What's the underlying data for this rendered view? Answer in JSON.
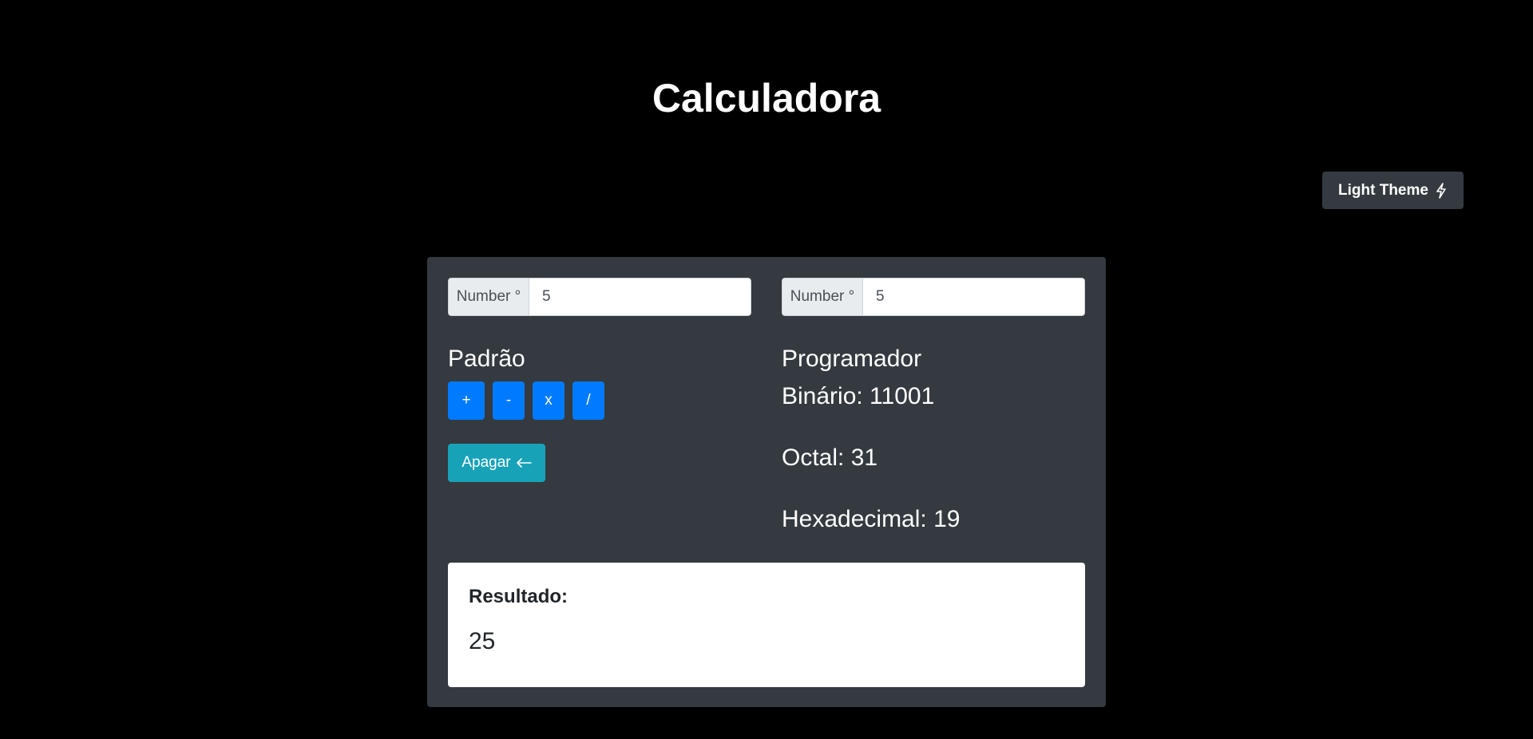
{
  "page": {
    "title": "Calculadora"
  },
  "theme_button": {
    "label": "Light Theme",
    "icon": "lightning-icon"
  },
  "inputs": {
    "first": {
      "addon": "Number °",
      "value": "5"
    },
    "second": {
      "addon": "Number °",
      "value": "5"
    }
  },
  "standard": {
    "title": "Padrão",
    "operations": [
      "+",
      "-",
      "x",
      "/"
    ],
    "clear_label": "Apagar",
    "clear_icon": "arrow-left-icon"
  },
  "programmer": {
    "title": "Programador",
    "binary": "Binário: 11001",
    "octal": "Octal: 31",
    "hexadecimal": "Hexadecimal: 19"
  },
  "result": {
    "label": "Resultado:",
    "value": "25"
  },
  "colors": {
    "background": "#000000",
    "card": "#343a40",
    "primary": "#007bff",
    "info": "#17a2b8",
    "text": "#ffffff"
  }
}
